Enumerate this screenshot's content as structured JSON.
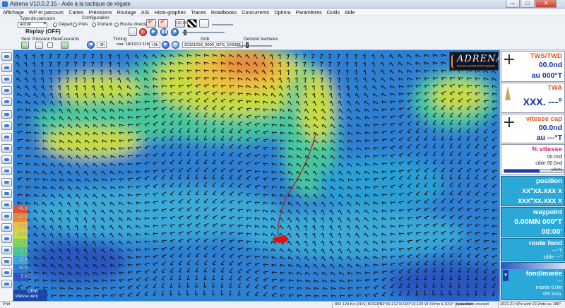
{
  "window": {
    "title": "Adrena V10.0.2.15 - Aide à la tactique de régate",
    "controls": {
      "minimize": "–",
      "maximize": "□",
      "close": "✕"
    }
  },
  "menu": [
    "Affichage",
    "WP et parcours",
    "Cartes",
    "Prévisions",
    "Routage",
    "AIS",
    "Histo-graphes",
    "Traces",
    "Roadbooks",
    "Concurrents",
    "Optima",
    "Paramètres",
    "Outils",
    "Aide"
  ],
  "toolbar": {
    "type_parcours_label": "Type de parcours",
    "type_parcours_value": "aucun",
    "configuration_label": "Configuration",
    "radio_depart": "Départ",
    "radio_pres": "Près",
    "radio_portant": "Portant",
    "radio_route_directe": "Route directe",
    "replay": "Replay (OFF)",
    "vent_label": "Vent",
    "pression_label": "Pression",
    "pluie_label": "Pluie",
    "courants_label": "Courants",
    "timing_label": "Timing",
    "grib_label": "Grib",
    "densite_label": "Densité barbules",
    "step_value": "-3h",
    "time_value": "mar. 18/12/12 11h37",
    "step_plus": "+3h",
    "grib_file": "20121218_0000_GFS_103308",
    "badge1": "6°",
    "badge2": "4°",
    "badge3": "100 88"
  },
  "legend": {
    "unit_cells": [
      "45.0",
      "40.0",
      "35.0",
      "30.0",
      "25.0",
      "20.0",
      "15.0",
      "10.0",
      "5.0"
    ],
    "colors": [
      "#d9553a",
      "#e78a3c",
      "#ecc13f",
      "#c6dc43",
      "#7fd35a",
      "#47c69d",
      "#3aa8d8",
      "#2a7dd3",
      "#2a56c0"
    ],
    "grib_tag": "GRIB",
    "vitesse_vent": "Vitesse vent"
  },
  "right_panel": {
    "tws_twd": {
      "title": "TWS/TWD",
      "speed": "00.0nd",
      "dir": "au 000°T"
    },
    "twa": {
      "title": "TWA",
      "value": "XXX. ---°"
    },
    "vitesse_cap": {
      "title": "vitesse cap",
      "speed": "00.0nd",
      "dir": "au ---°T"
    },
    "pct_vitesse": {
      "title": "% vitesse",
      "line1": "00.0nd",
      "line2": "cible 00.0nd",
      "bar_value": 0.6,
      "bar_text": "###%"
    },
    "position": {
      "title": "position",
      "lat": "xx°xx.xxx x",
      "lon": "xxx°xx.xxx x"
    },
    "waypoint": {
      "title": "waypoint",
      "dist": "0.00MN 000°T",
      "time": "00:00'"
    },
    "route_fond": {
      "title": "route fond",
      "line1": "---°T",
      "line2": "cible ---°"
    },
    "fond_maree": {
      "title": "fond/marée",
      "line1": "---",
      "line2": "marée 0.0m",
      "line3": "0% inco."
    }
  },
  "logo": {
    "brand": "ADRENA",
    "tagline": "NAVIGATION SOFTWARE"
  },
  "statusbar": {
    "ready": "Prêt",
    "memory": "882 124 Ko (31%) NOGPS",
    "coords": "32°09.212 N  020°10.120 W  XXmn à XXX° du bateau",
    "info": "pas d'info courant",
    "pressure": "1021.21 hPa  vent 10.2nds au 186°"
  }
}
